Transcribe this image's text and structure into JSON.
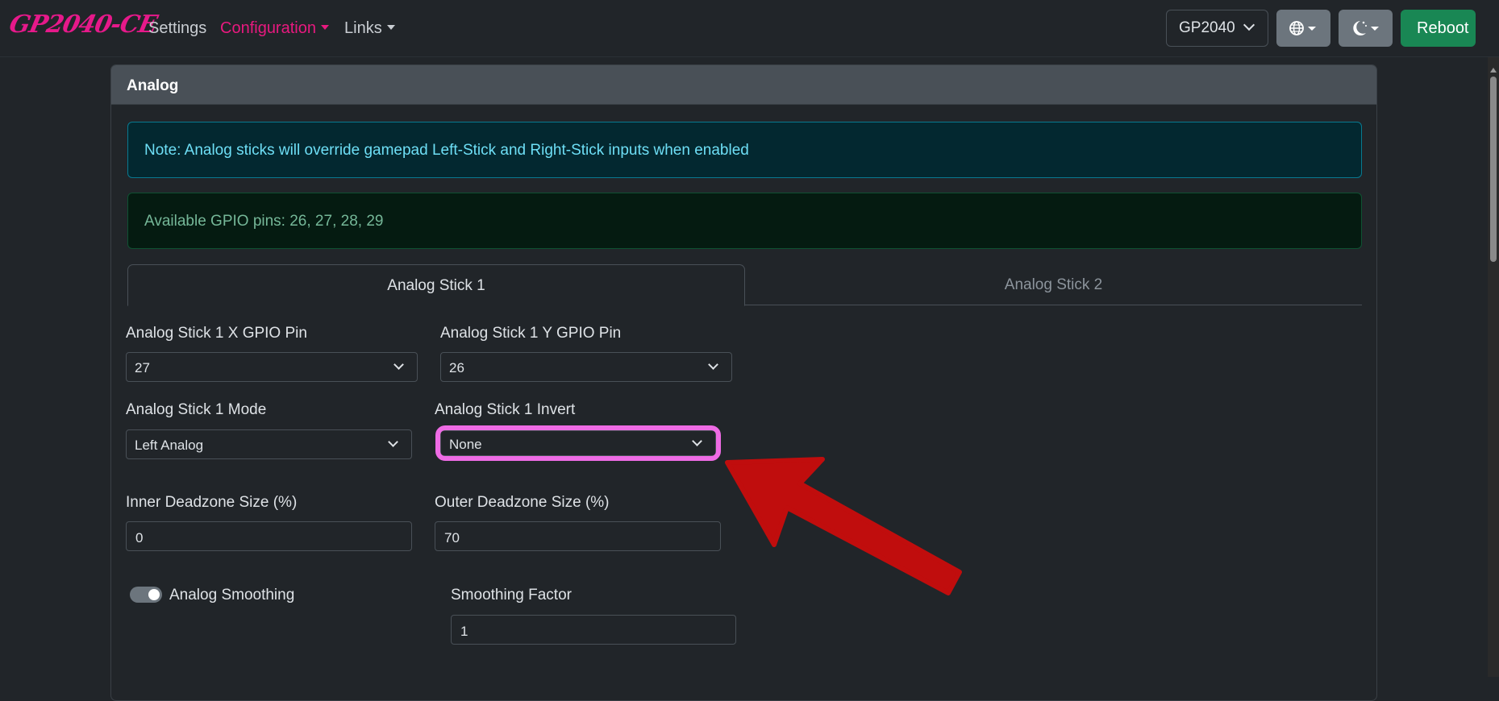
{
  "navbar": {
    "logo": "GP2040-CE",
    "links": [
      {
        "label": "Settings",
        "active": false
      },
      {
        "label": "Configuration",
        "active": true
      },
      {
        "label": "Links",
        "active": false
      }
    ],
    "board_select": "GP2040",
    "language_icon": "globe-icon",
    "theme_icon": "moon-stars-icon",
    "reboot_label": "Reboot"
  },
  "card": {
    "title": "Analog",
    "note": "Note: Analog sticks will override gamepad Left-Stick and Right-Stick inputs when enabled",
    "available_pins": "Available GPIO pins: 26, 27, 28, 29",
    "tabs": [
      {
        "label": "Analog Stick 1",
        "active": true
      },
      {
        "label": "Analog Stick 2",
        "active": false
      }
    ],
    "fields": {
      "x_pin": {
        "label": "Analog Stick 1 X GPIO Pin",
        "value": "27"
      },
      "y_pin": {
        "label": "Analog Stick 1 Y GPIO Pin",
        "value": "26"
      },
      "mode": {
        "label": "Analog Stick 1 Mode",
        "value": "Left Analog"
      },
      "invert": {
        "label": "Analog Stick 1 Invert",
        "value": "None"
      },
      "inner_deadzone": {
        "label": "Inner Deadzone Size (%)",
        "value": "0"
      },
      "outer_deadzone": {
        "label": "Outer Deadzone Size (%)",
        "value": "70"
      },
      "smoothing": {
        "label": "Analog Smoothing",
        "enabled": true
      },
      "smoothing_factor": {
        "label": "Smoothing Factor",
        "value": "1"
      }
    }
  },
  "annotation": {
    "highlight_color": "#ee6be4",
    "arrow_color": "#c00d0d"
  }
}
